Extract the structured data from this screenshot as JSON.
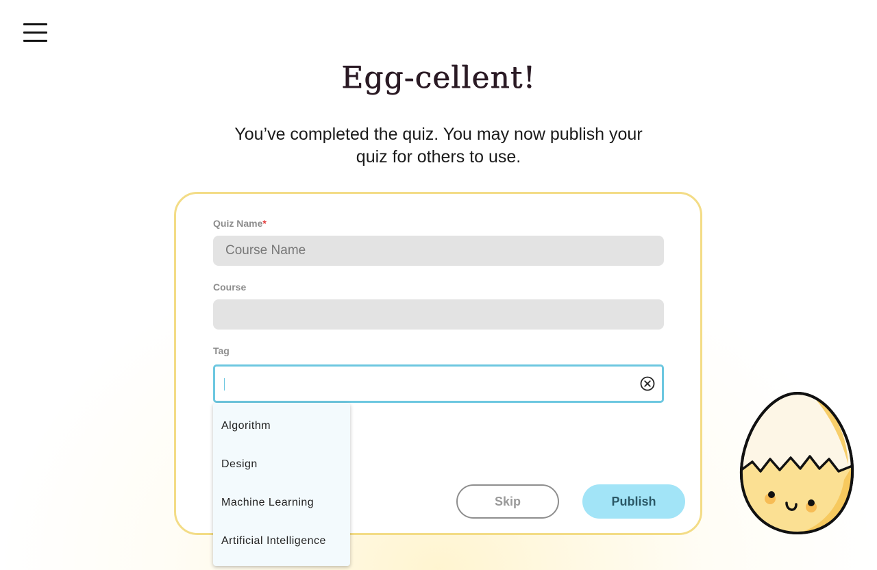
{
  "header": {
    "menu_icon": "hamburger-menu-icon"
  },
  "hero": {
    "title": "Egg-cellent!",
    "subtitle_line1": "You’ve completed the quiz. You may now publish your",
    "subtitle_line2": "quiz for others to use."
  },
  "form": {
    "quiz_name": {
      "label": "Quiz Name",
      "required_mark": "*",
      "placeholder": "Course Name",
      "value": ""
    },
    "course": {
      "label": "Course",
      "value": ""
    },
    "tag": {
      "label": "Tag",
      "value": "",
      "clear_icon": "clear-circle-x-icon",
      "options": [
        "Algorithm",
        "Design",
        "Machine Learning",
        "Artificial Intelligence"
      ]
    }
  },
  "actions": {
    "skip_label": "Skip",
    "publish_label": "Publish"
  },
  "mascot": {
    "icon": "cracked-egg-mascot"
  },
  "colors": {
    "card_border": "#f3dc86",
    "focus_border": "#6cc7e0",
    "publish_button": "#a2e4f7",
    "required_mark": "#e23b3b"
  }
}
